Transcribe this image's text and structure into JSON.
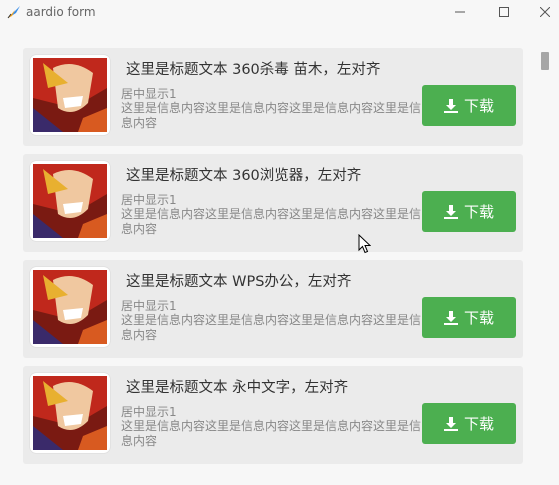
{
  "window": {
    "title": "aardio form"
  },
  "icons": {
    "app": "aardio-feather-icon",
    "minimize": "minimize-icon",
    "maximize": "maximize-icon",
    "close": "close-icon",
    "download": "download-icon"
  },
  "colors": {
    "accent": "#4caf50",
    "card": "#ebebeb",
    "background": "#f7f7f7"
  },
  "items": [
    {
      "title": "这里是标题文本 360杀毒  苗木，左对齐",
      "subtitle": "居中显示1",
      "description": "这里是信息内容这里是信息内容这里是信息内容这里是信息内容",
      "button": "下载"
    },
    {
      "title": "这里是标题文本 360浏览器，左对齐",
      "subtitle": "居中显示1",
      "description": "这里是信息内容这里是信息内容这里是信息内容这里是信息内容",
      "button": "下载"
    },
    {
      "title": "这里是标题文本 WPS办公，左对齐",
      "subtitle": "居中显示1",
      "description": "这里是信息内容这里是信息内容这里是信息内容这里是信息内容",
      "button": "下载"
    },
    {
      "title": "这里是标题文本 永中文字，左对齐",
      "subtitle": "居中显示1",
      "description": "这里是信息内容这里是信息内容这里是信息内容这里是信息内容",
      "button": "下载"
    }
  ]
}
